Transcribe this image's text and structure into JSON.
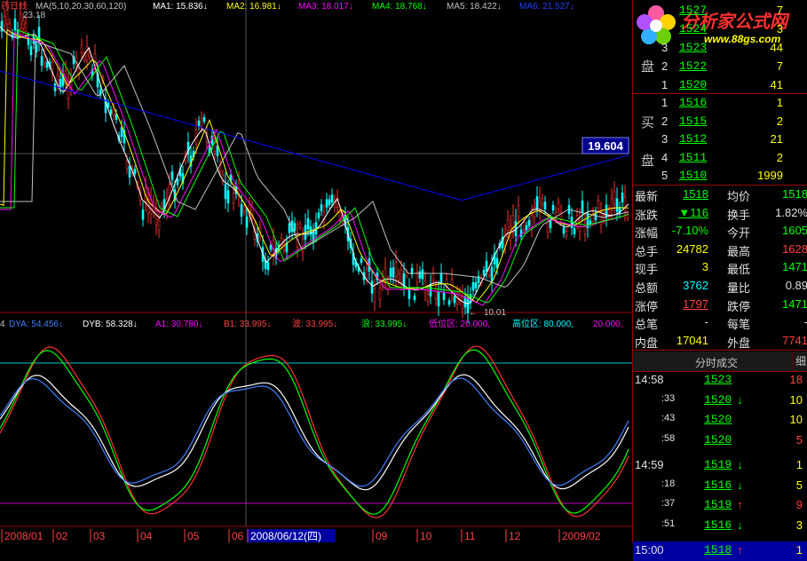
{
  "kline_header": {
    "prefix": "药日线",
    "ma_def": "MA(5,10,20,30,60,120)",
    "ma1": "MA1: 15.836↓",
    "ma2": "MA2: 16.981↓",
    "ma3": "MA3: 18.017↓",
    "ma4": "MA4: 18.768↓",
    "ma5": "MA5: 18.422↓",
    "ma6": "MA6: 21.527↓",
    "high_mark": "23.18"
  },
  "price_label": "19.604",
  "low_mark": "10.01",
  "ind_header": {
    "prefix": "4",
    "dya": "DYA: 54.456↓",
    "dyb": "DYB: 58.328↓",
    "a1": "A1: 30.780↓",
    "b1": "B1: 33.995↓",
    "bo": "波: 33.995↓",
    "lang": "浪: 33.995↓",
    "low_zone": "低位区: 20.000,",
    "high_zone": "高位区: 80.000,",
    "tail": "20.000,"
  },
  "dates": [
    "2008/01",
    "02",
    "03",
    "04",
    "05",
    "06",
    "2008/06/12(四)",
    "09",
    "10",
    "11",
    "12",
    "2009/02"
  ],
  "logo": {
    "text": "分析家公式网",
    "url": "www.88gs.com"
  },
  "sell_rows": [
    {
      "n": "",
      "price": "1527",
      "vol": "7"
    },
    {
      "n": "",
      "price": "1524",
      "vol": "3"
    },
    {
      "n": "3",
      "price": "1523",
      "vol": "44"
    },
    {
      "n": "2",
      "price": "1522",
      "vol": "7"
    },
    {
      "n": "1",
      "price": "1520",
      "vol": "41"
    }
  ],
  "sell_label": "盘",
  "buy_label_1": "买",
  "buy_label_2": "盘",
  "buy_rows": [
    {
      "n": "1",
      "price": "1516",
      "vol": "1"
    },
    {
      "n": "2",
      "price": "1515",
      "vol": "2"
    },
    {
      "n": "3",
      "price": "1512",
      "vol": "21"
    },
    {
      "n": "4",
      "price": "1511",
      "vol": "2"
    },
    {
      "n": "5",
      "price": "1510",
      "vol": "1999"
    }
  ],
  "stats": [
    {
      "l1": "最新",
      "v1": "1518",
      "l2": "均价",
      "v2": "1518"
    },
    {
      "l1": "涨跌",
      "v1": "▼116",
      "l2": "换手",
      "v2": "1.82%"
    },
    {
      "l1": "涨幅",
      "v1": "-7.10%",
      "l2": "今开",
      "v2": "1605"
    },
    {
      "l1": "总手",
      "v1": "24782",
      "l2": "最高",
      "v2": "1628"
    },
    {
      "l1": "现手",
      "v1": "3",
      "l2": "最低",
      "v2": "1471"
    },
    {
      "l1": "总额",
      "v1": "3762",
      "l2": "量比",
      "v2": "0.89"
    },
    {
      "l1": "涨停",
      "v1": "1797",
      "l2": "跌停",
      "v2": "1471"
    },
    {
      "l1": "总笔",
      "v1": "-",
      "l2": "每笔",
      "v2": "-"
    },
    {
      "l1": "内盘",
      "v1": "17041",
      "l2": "外盘",
      "v2": "7741"
    }
  ],
  "tick_header": "分时成交",
  "tick_tab": "细",
  "ticks": [
    {
      "t": "14:58",
      "p": "1523",
      "a": "",
      "v": "18"
    },
    {
      "t": ":33",
      "p": "1520",
      "a": "↓",
      "v": "10"
    },
    {
      "t": ":43",
      "p": "1520",
      "a": "",
      "v": "10"
    },
    {
      "t": ":58",
      "p": "1520",
      "a": "",
      "v": "5"
    },
    {
      "t": "14:59",
      "p": "1519",
      "a": "↓",
      "v": "1"
    },
    {
      "t": ":18",
      "p": "1516",
      "a": "↓",
      "v": "5"
    },
    {
      "t": ":37",
      "p": "1519",
      "a": "↑",
      "v": "9"
    },
    {
      "t": ":51",
      "p": "1516",
      "a": "↓",
      "v": "3"
    },
    {
      "t": "15:00",
      "p": "1518",
      "a": "↑",
      "v": "1"
    }
  ],
  "colors": {
    "ma1": "#ffffff",
    "ma2": "#ffff00",
    "ma3": "#ff00ff",
    "ma4": "#00ff00",
    "ma5": "#c0c0c0",
    "ma6": "#0000ff",
    "up": "#ff0000",
    "down": "#00ffff"
  }
}
